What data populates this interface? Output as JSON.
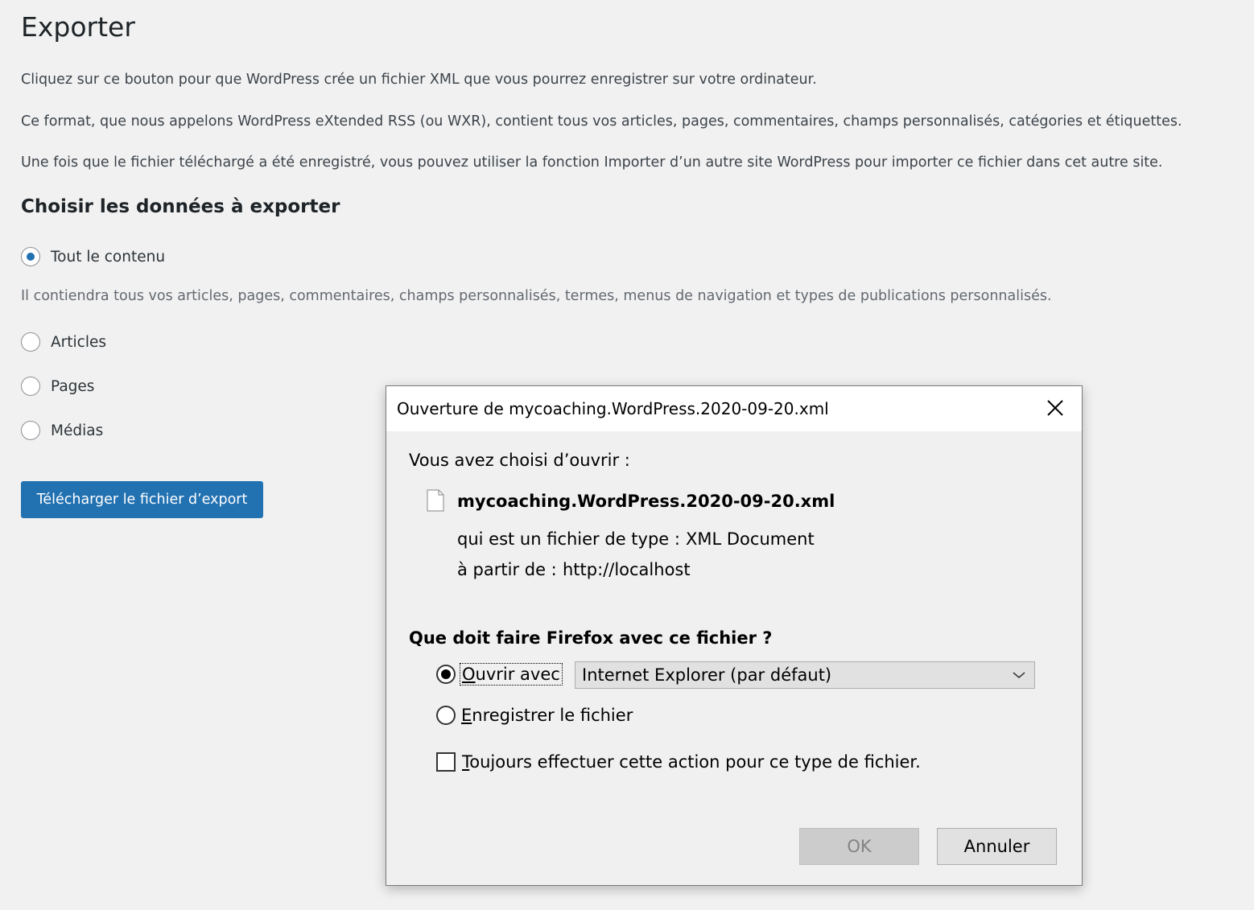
{
  "page": {
    "title": "Exporter",
    "intro": [
      "Cliquez sur ce bouton pour que WordPress crée un fichier XML que vous pourrez enregistrer sur votre ordinateur.",
      "Ce format, que nous appelons WordPress eXtended RSS (ou WXR), contient tous vos articles, pages, commentaires, champs personnalisés, catégories et étiquettes.",
      "Une fois que le fichier téléchargé a été enregistré, vous pouvez utiliser la fonction Importer d’un autre site WordPress pour importer ce fichier dans cet autre site."
    ],
    "section_title": "Choisir les données à exporter",
    "options": [
      {
        "label": "Tout le contenu",
        "checked": true
      },
      {
        "label": "Articles",
        "checked": false
      },
      {
        "label": "Pages",
        "checked": false
      },
      {
        "label": "Médias",
        "checked": false
      }
    ],
    "all_content_description": "Il contiendra tous vos articles, pages, commentaires, champs personnalisés, termes, menus de navigation et types de publications personnalisés.",
    "download_button": "Télécharger le fichier d’export",
    "accent_color": "#2271b1"
  },
  "dialog": {
    "title": "Ouverture de mycoaching.WordPress.2020-09-20.xml",
    "chosen_label": "Vous avez choisi d’ouvrir :",
    "file_name": "mycoaching.WordPress.2020-09-20.xml",
    "type_label": "qui est un fichier de type :",
    "type_value": "XML Document",
    "from_label": "à partir de :",
    "from_value": "http://localhost",
    "question": "Que doit faire Firefox avec ce fichier ?",
    "open_with": {
      "first_letter": "O",
      "rest": "uvrir avec",
      "selected": true
    },
    "open_with_app": "Internet Explorer (par défaut)",
    "save_file": {
      "first_letter": "E",
      "rest": "nregistrer le fichier",
      "selected": false
    },
    "always": {
      "first_letter": "T",
      "rest": "oujours effectuer cette action pour ce type de fichier.",
      "checked": false
    },
    "ok_button": "OK",
    "cancel_button": "Annuler",
    "close_icon": "close-icon",
    "file_icon": "document-icon"
  }
}
